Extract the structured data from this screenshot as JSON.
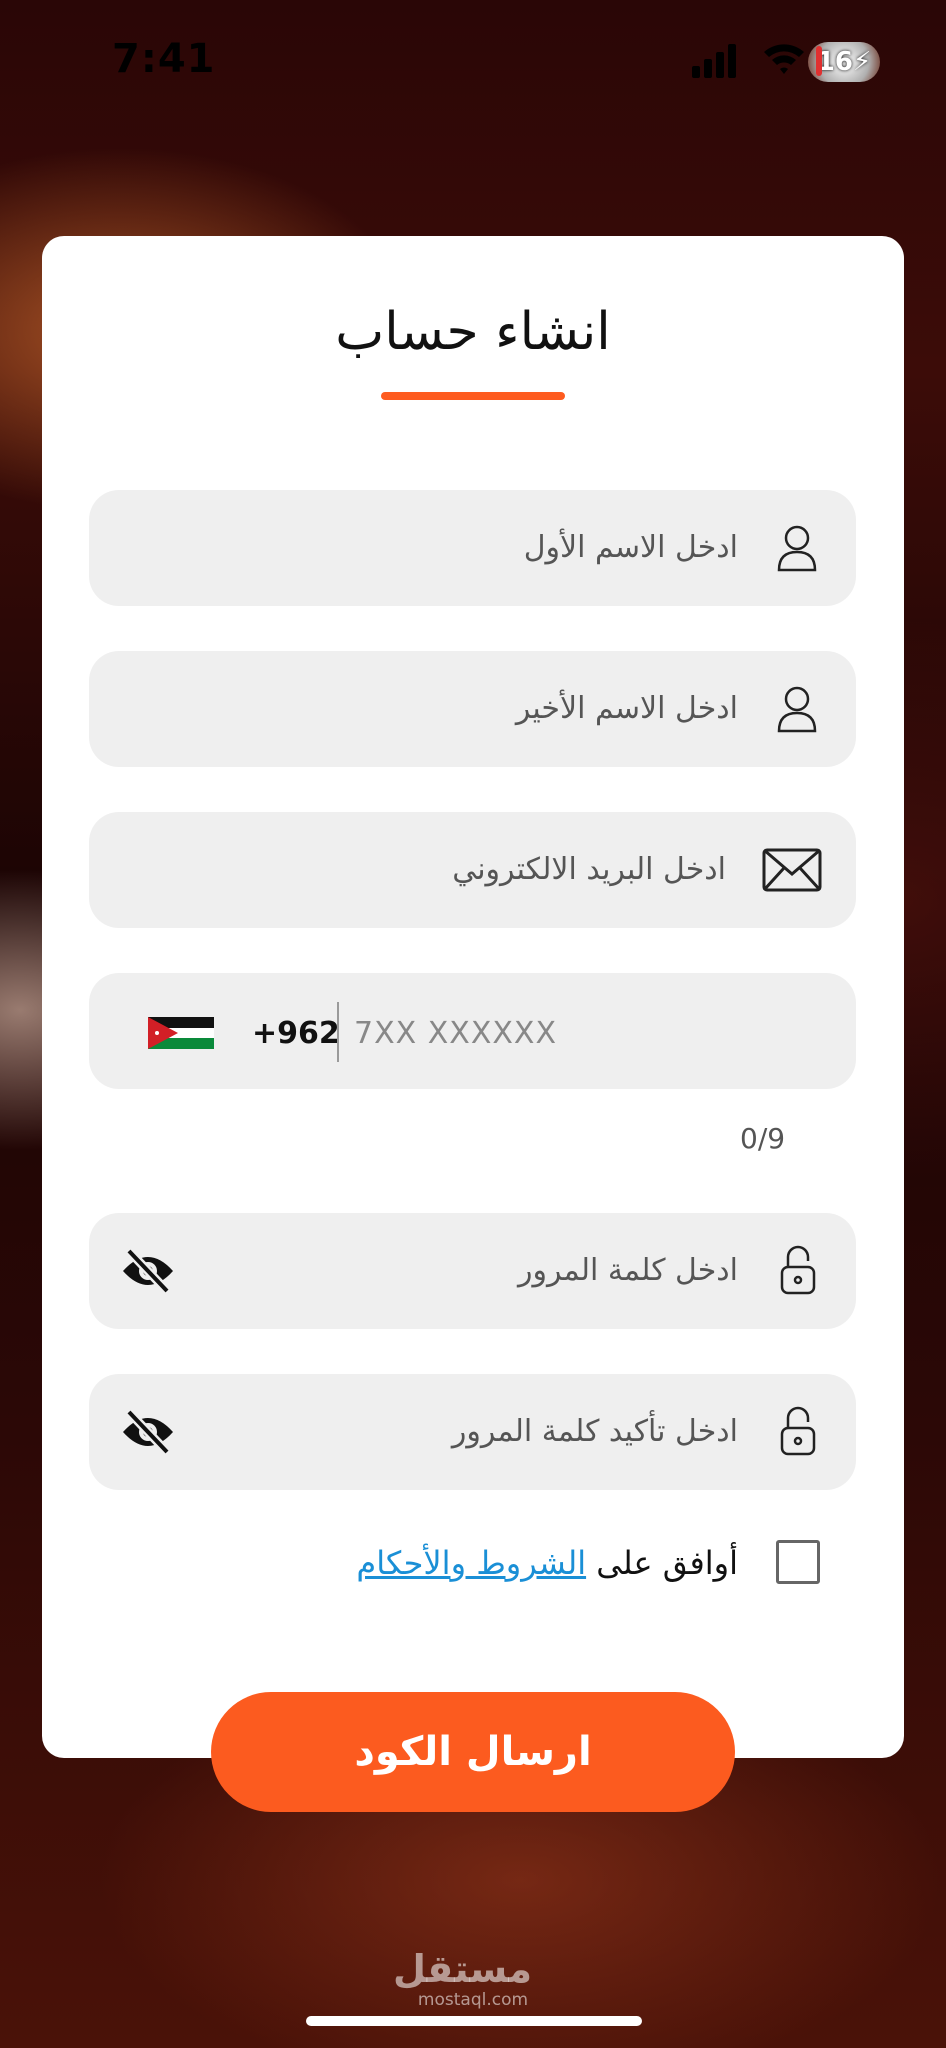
{
  "status_bar": {
    "time": "7:41",
    "battery": "16"
  },
  "form": {
    "title": "انشاء حساب",
    "first_name_placeholder": "ادخل الاسم الأول",
    "last_name_placeholder": "ادخل الاسم الأخير",
    "email_placeholder": "ادخل البريد الالكتروني",
    "phone": {
      "country_code": "+962",
      "placeholder": "7XX XXXXXX",
      "counter": "0/9"
    },
    "password_placeholder": "ادخل كلمة المرور",
    "confirm_password_placeholder": "ادخل تأكيد كلمة المرور",
    "terms": {
      "prefix": "أوافق على ",
      "link": "الشروط والأحكام"
    },
    "submit_label": "ارسال الكود"
  },
  "watermark": {
    "arabic": "مستقل",
    "latin": "mostaql.com"
  },
  "colors": {
    "accent": "#fc5b1f",
    "field_bg": "#efefef",
    "link": "#1a8fd6"
  }
}
